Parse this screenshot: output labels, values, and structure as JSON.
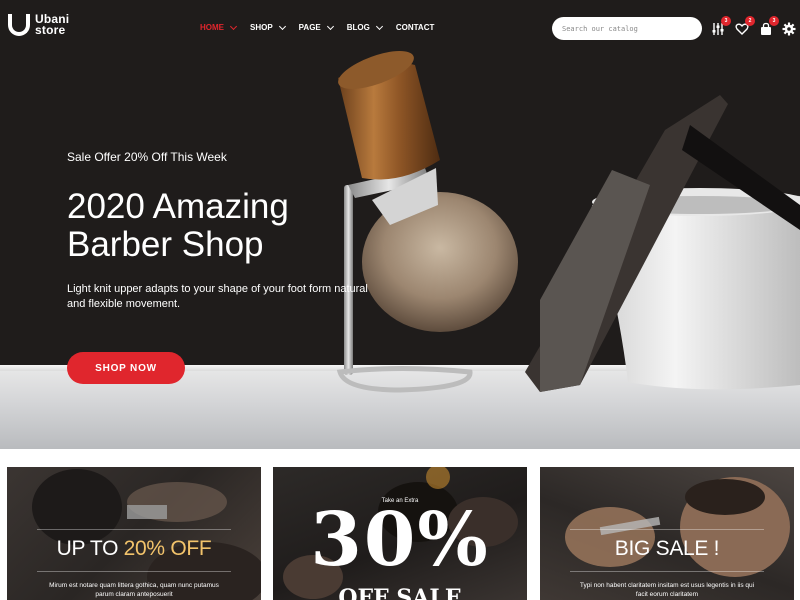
{
  "brand": {
    "name_line1": "Ubani",
    "name_line2": "store"
  },
  "nav": [
    {
      "label": "HOME"
    },
    {
      "label": "SHOP"
    },
    {
      "label": "PAGE"
    },
    {
      "label": "BLOG"
    },
    {
      "label": "CONTACT"
    }
  ],
  "search": {
    "placeholder": "Search our catalog"
  },
  "header_icons": {
    "compare_count": "3",
    "wishlist_count": "2",
    "cart_count": "3"
  },
  "hero": {
    "offer": "Sale Offer 20% Off This Week",
    "title": "2020 Amazing Barber Shop",
    "description": "Light knit upper adapts to your shape of your foot form natural and flexible movement.",
    "button": "SHOP NOW"
  },
  "banners": [
    {
      "title_prefix": "UP TO ",
      "title_highlight": "20% OFF",
      "text": "Mirum est notare quam littera gothica, quam nunc putamus parum claram anteposuerit"
    },
    {
      "extra": "Take an Extra",
      "big": "30%",
      "sale": "OFF SALE"
    },
    {
      "title": "BIG SALE !",
      "text": "Typi non habent claritatem insitam est usus legentis in iis qui facit eorum claritatem"
    }
  ],
  "colors": {
    "accent": "#e0262d",
    "highlight": "#f2c36b",
    "hero_bg": "#1f1c1b"
  }
}
